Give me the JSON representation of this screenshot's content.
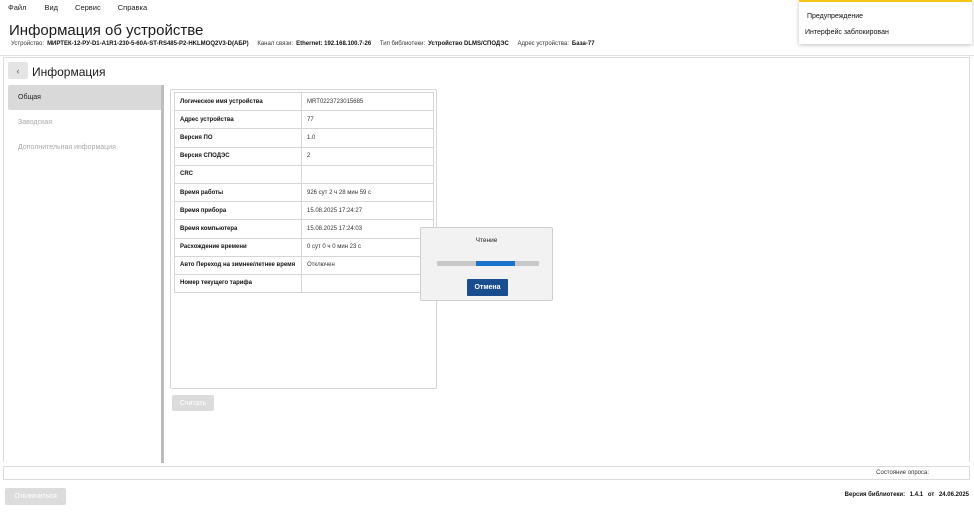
{
  "menu": [
    "Файл",
    "Вид",
    "Сервис",
    "Справка"
  ],
  "header": {
    "title": "Информация об устройстве",
    "device_label": "Устройство:",
    "device_value": "МИРТЕК-12-РУ-D1-A1R1-230-5-60А-ST-RS485-P2-HKLMOQ2V3-D(АБР)",
    "channel_label": "Канал связи:",
    "channel_value": "Ethernet: 192.168.100.7-26",
    "lib_type_label": "Тип библиотеки:",
    "lib_type_value": "Устройство DLMS/СПОДЭС",
    "address_label": "Адрес устройства:",
    "address_value": "База-77"
  },
  "notification": {
    "title": "Предупреждение",
    "text": "Интерфейс заблокирован",
    "accent_color": "#f5c518"
  },
  "panel": {
    "back_icon": "chevron-left-icon",
    "title": "Информация",
    "sidebar": [
      {
        "label": "Общая",
        "active": true
      },
      {
        "label": "Заводская",
        "active": false
      },
      {
        "label": "Дополнительная информация",
        "active": false
      }
    ],
    "table": [
      {
        "key": "Логическое имя устройства",
        "value": "MRT0223723015685"
      },
      {
        "key": "Адрес устройства",
        "value": "77"
      },
      {
        "key": "Версия ПО",
        "value": "1.0"
      },
      {
        "key": "Версия СПОДЭС",
        "value": "2"
      },
      {
        "key": "CRC",
        "value": ""
      },
      {
        "key": "Время работы",
        "value": "926 сут 2 ч 28 мин 59 с"
      },
      {
        "key": "Время прибора",
        "value": "15.08.2025 17:24:27"
      },
      {
        "key": "Время компьютера",
        "value": "15.08.2025 17:24:03"
      },
      {
        "key": "Расхождение времени",
        "value": "0 сут 0 ч 0 мин 23 с"
      },
      {
        "key": "Авто Переход на зимнее/летнее время",
        "value": "Отключен"
      },
      {
        "key": "Номер текущего тарифа",
        "value": ""
      }
    ],
    "read_button": "Считать"
  },
  "dialog": {
    "title": "Чтение",
    "progress_percent": 62,
    "progress_color": "#1b74c9",
    "cancel_button": "Отмена"
  },
  "status": {
    "label": "Состояние опроса:"
  },
  "footer": {
    "disconnect_button": "Отключиться",
    "version_label": "Версия библиотеки:",
    "version_value": "1.4.1",
    "from_label": "от",
    "date_value": "24.06.2025"
  }
}
